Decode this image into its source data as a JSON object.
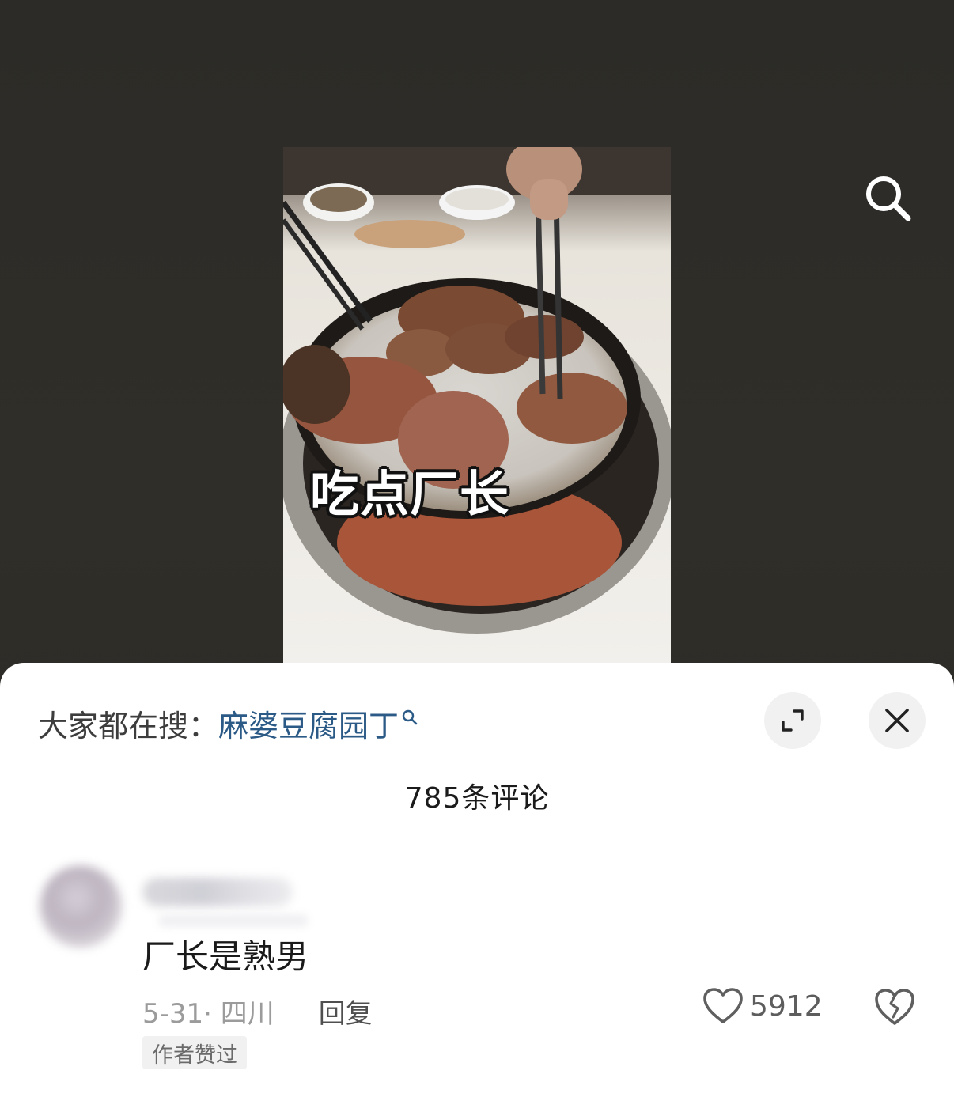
{
  "video": {
    "caption": "吃点厂长",
    "search_icon": "search-icon"
  },
  "comment_panel": {
    "trending_prefix": "大家都在搜：",
    "trending_query": "麻婆豆腐园丁",
    "trending_icon": "search-small-icon",
    "expand_icon": "expand-icon",
    "close_icon": "close-icon",
    "comment_count_label": "785条评论"
  },
  "comments": [
    {
      "text": "厂长是熟男",
      "date_location": "5-31· 四川",
      "reply_label": "回复",
      "likes": "5912",
      "like_icon": "heart-icon",
      "dislike_icon": "broken-heart-icon",
      "badge": "作者赞过"
    }
  ],
  "colors": {
    "link": "#2b5a86",
    "background": "#2c2b27"
  }
}
